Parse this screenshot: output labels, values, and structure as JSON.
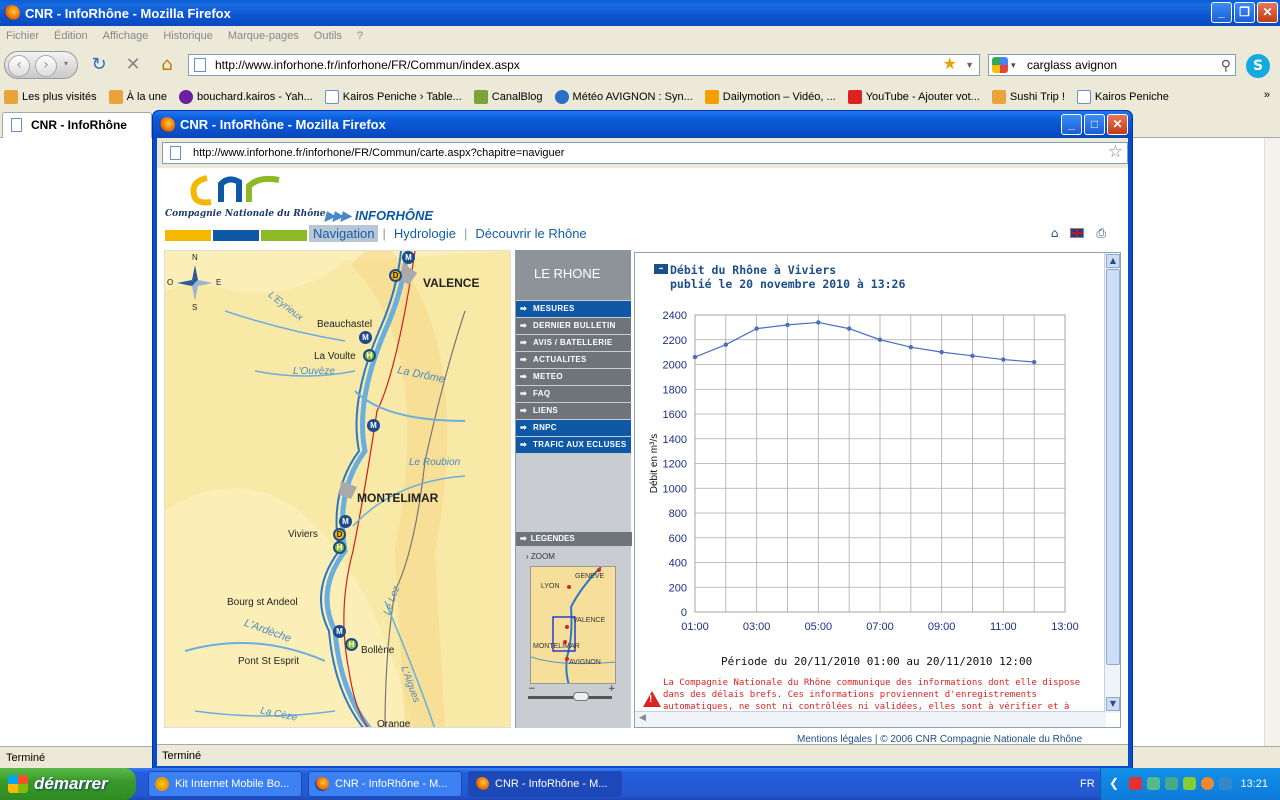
{
  "main_window": {
    "title": "CNR - InfoRhône - Mozilla Firefox",
    "menu": [
      "Fichier",
      "Édition",
      "Affichage",
      "Historique",
      "Marque-pages",
      "Outils",
      "?"
    ],
    "url": "http://www.inforhone.fr/inforhone/FR/Commun/index.aspx",
    "search_value": "carglass avignon",
    "bookmarks": [
      "Les plus visités",
      "À la une",
      "bouchard.kairos - Yah...",
      "Kairos Peniche › Table...",
      "CanalBlog",
      "Météo AVIGNON : Syn...",
      "Dailymotion – Vidéo, ...",
      "YouTube - Ajouter vot...",
      "Sushi Trip !",
      "Kairos Peniche"
    ],
    "bookmarks_more": "»",
    "tab_label": "CNR - InfoRhône",
    "status": "Terminé"
  },
  "popup": {
    "title": "CNR - InfoRhône - Mozilla Firefox",
    "url": "http://www.inforhone.fr/inforhone/FR/Commun/carte.aspx?chapitre=naviguer",
    "status": "Terminé",
    "logo_subtitle": "Compagnie Nationale du Rhône",
    "brand": "INFORHÔNE",
    "brand_colors": [
      "#f5b800",
      "#0f58a6",
      "#8db924"
    ],
    "nav": [
      "Navigation",
      "Hydrologie",
      "Découvrir le Rhône"
    ],
    "nav_active": "Navigation",
    "top_icons": [
      "home-icon",
      "uk-flag-icon",
      "print-icon"
    ],
    "map": {
      "cities": [
        "VALENCE",
        "MONTELIMAR"
      ],
      "towns": [
        "Beauchastel",
        "La Voulte",
        "Viviers",
        "Bourg st Andeol",
        "Bollène",
        "Pont St Esprit",
        "Orange"
      ],
      "rivers": [
        "L'Eyrieux",
        "L'Ouvèze",
        "La Drôme",
        "Le Roubion",
        "L'Ardèche",
        "Le Lez",
        "L'Aigues",
        "La Cèze"
      ],
      "compass": [
        "N",
        "S",
        "E",
        "O"
      ]
    },
    "side_menu": {
      "header": "LE RHONE",
      "items": [
        {
          "label": "MESURES",
          "style": "blue"
        },
        {
          "label": "DERNIER BULLETIN",
          "style": "grey"
        },
        {
          "label": "AVIS / BATELLERIE",
          "style": "grey"
        },
        {
          "label": "ACTUALITES",
          "style": "grey"
        },
        {
          "label": "METEO",
          "style": "grey"
        },
        {
          "label": "FAQ",
          "style": "grey"
        },
        {
          "label": "LIENS",
          "style": "grey"
        },
        {
          "label": "RNPC",
          "style": "blue"
        },
        {
          "label": "TRAFIC AUX ECLUSES",
          "style": "blue"
        }
      ],
      "legendes": "LEGENDES",
      "zoom": "ZOOM",
      "minimap_labels": [
        "GENEVE",
        "LYON",
        "VALENCE",
        "MONTELIMAR",
        "AVIGNON"
      ],
      "slider_minus": "−",
      "slider_plus": "+"
    },
    "chart_panel": {
      "title_line1": "Débit du Rhône à Viviers",
      "title_line2": "publié le 20 novembre 2010 à 13:26",
      "periode": "Période du 20/11/2010 01:00 au 20/11/2010 12:00",
      "warning": "La Compagnie Nationale du Rhône communique des informations dont elle dispose dans des délais brefs. Ces informations proviennent d'enregistrements automatiques, ne sont ni contrôlées ni validées, elles sont à vérifier et à interpréter sous la seule"
    },
    "footer": "Mentions légales | © 2006 CNR Compagnie Nationale du Rhône"
  },
  "chart_data": {
    "type": "line",
    "title": "Débit du Rhône à Viviers",
    "ylabel": "Débit en m³/s",
    "xlabel": "",
    "xticks": [
      "01:00",
      "03:00",
      "05:00",
      "07:00",
      "09:00",
      "11:00",
      "13:00"
    ],
    "yticks": [
      0,
      200,
      400,
      600,
      800,
      1000,
      1200,
      1400,
      1600,
      1800,
      2000,
      2200,
      2400
    ],
    "ylim": [
      0,
      2400
    ],
    "xlim": [
      1,
      13
    ],
    "grid": true,
    "series": [
      {
        "x": [
          1,
          2,
          3,
          4,
          5,
          6,
          7,
          8,
          9,
          10,
          11,
          12
        ],
        "values": [
          2060,
          2160,
          2290,
          2320,
          2340,
          2290,
          2200,
          2140,
          2100,
          2070,
          2040,
          2020
        ],
        "color": "#4a6fc0"
      }
    ]
  },
  "taskbar": {
    "start": "démarrer",
    "items": [
      "Kit Internet Mobile Bo...",
      "CNR - InfoRhône - M...",
      "CNR - InfoRhône - M..."
    ],
    "active_index": 2,
    "lang": "FR",
    "clock": "13:21"
  }
}
